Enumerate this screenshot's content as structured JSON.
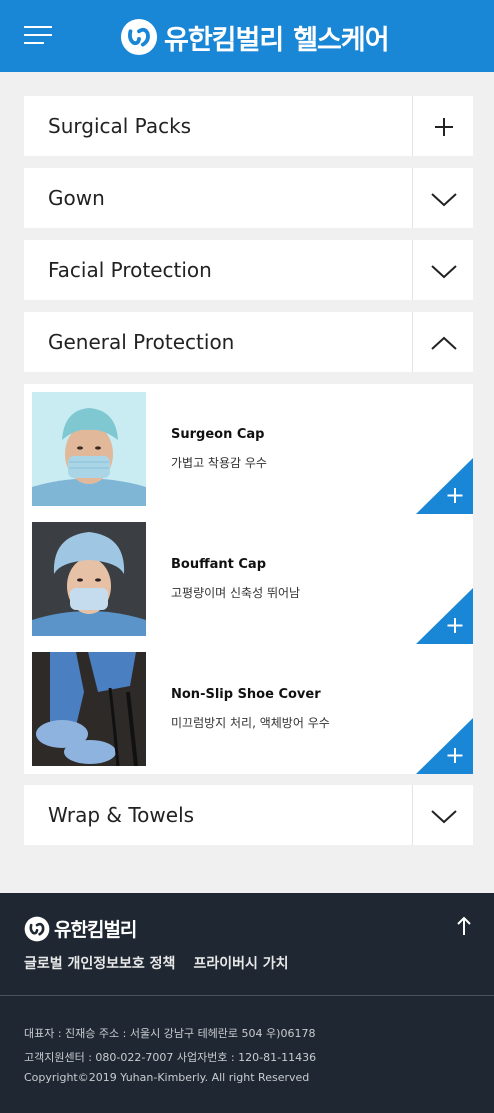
{
  "header": {
    "brand_name": "유한킴벌리",
    "brand_sub": "헬스케어",
    "menu_icon": "hamburger-menu-icon",
    "background_color": "#1a86d6"
  },
  "accordion": [
    {
      "title": "Surgical Packs",
      "icon": "plus-icon",
      "state": "collapsed"
    },
    {
      "title": "Gown",
      "icon": "chevron-down-icon",
      "state": "collapsed"
    },
    {
      "title": "Facial Protection",
      "icon": "chevron-down-icon",
      "state": "collapsed"
    },
    {
      "title": "General Protection",
      "icon": "chevron-up-icon",
      "state": "expanded"
    },
    {
      "title": "Wrap & Towels",
      "icon": "chevron-down-icon",
      "state": "collapsed"
    }
  ],
  "products": [
    {
      "name": "Surgeon Cap",
      "desc": "가볍고 착용감 우수",
      "image": "person-in-surgeon-cap-and-mask",
      "action_icon": "plus-icon"
    },
    {
      "name": "Bouffant Cap",
      "desc": "고평량이며 신축성 뛰어남",
      "image": "woman-in-bouffant-cap-and-mask",
      "action_icon": "plus-icon"
    },
    {
      "name": "Non-Slip Shoe Cover",
      "desc": "미끄럼방지 처리, 액체방어 우수",
      "image": "shoe-covers-on-feet",
      "action_icon": "plus-icon"
    }
  ],
  "footer": {
    "logo_text": "유한킴벌리",
    "links": [
      "글로벌 개인정보보호 정책",
      "프라이버시 가치"
    ],
    "info_line1": "대표자 : 진재승 주소 : 서울시 강남구 테헤란로 504 우)06178",
    "info_line2": "고객지원센터 : 080-022-7007 사업자번호 : 120-81-11436",
    "copyright": "Copyright©2019 Yuhan-Kimberly. All right Reserved",
    "top_icon": "arrow-up-icon",
    "background_color": "#1f2732"
  },
  "colors": {
    "accent": "#1a86d6",
    "page_bg": "#f0f0f0"
  }
}
